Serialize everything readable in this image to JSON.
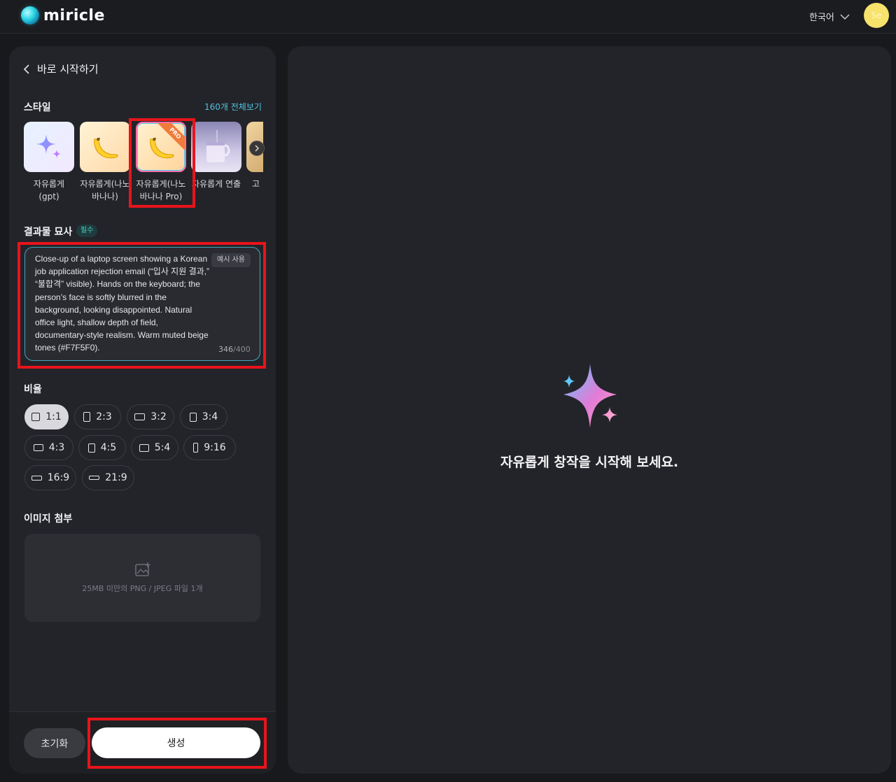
{
  "header": {
    "brand": "miricle",
    "language": "한국어",
    "avatar_initials": "Se"
  },
  "sidebar": {
    "back_title": "바로 시작하기",
    "style_section": {
      "label": "스타일",
      "see_all": "160개 전체보기",
      "items": [
        {
          "name": "자유롭게\n(gpt)",
          "thumb": "sparkle-icon"
        },
        {
          "name": "자유롭게(나노\n바나나)",
          "thumb": "banana-icon"
        },
        {
          "name": "자유롭게(나노\n바나나 Pro)",
          "thumb": "banana-icon",
          "badge": "PRO",
          "selected": true
        },
        {
          "name": "자유롭게 연출",
          "thumb": "cup-photo"
        },
        {
          "name": "고",
          "thumb": "photo"
        }
      ]
    },
    "description": {
      "label": "결과물 묘사",
      "required_badge": "필수",
      "example_button": "예시 사용",
      "text": "Close-up of a laptop screen showing a Korean job application rejection email (“입사 지원 결과,” “불합격” visible). Hands on the keyboard; the person’s face is softly blurred in the background, looking disappointed. Natural office light, shallow depth of field, documentary-style realism. Warm muted beige tones (#F7F5F0).",
      "count": "346",
      "max": "/400"
    },
    "ratio": {
      "label": "비율",
      "options": [
        "1:1",
        "2:3",
        "3:2",
        "3:4",
        "4:3",
        "4:5",
        "5:4",
        "9:16",
        "16:9",
        "21:9"
      ],
      "selected": "1:1"
    },
    "attachment": {
      "label": "이미지 첨부",
      "hint": "25MB 미만의 PNG / JPEG 파일 1개"
    },
    "footer": {
      "reset": "초기화",
      "generate": "생성"
    }
  },
  "main": {
    "empty_message": "자유롭게 창작을 시작해 보세요."
  },
  "colors": {
    "accent": "#4fc3e0",
    "highlight": "#e8141b",
    "avatar": "#f7e26b"
  }
}
